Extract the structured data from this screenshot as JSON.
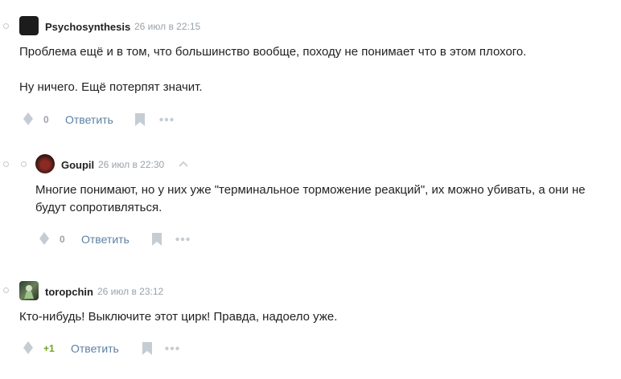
{
  "comments": [
    {
      "author": "Psychosynthesis",
      "time": "26 июл в 22:15",
      "text1": "Проблема ещё и в том, что большинство вообще, походу не понимает что в этом плохого.",
      "text2": "Ну ничего. Ещё потерпят значит.",
      "votes": "0",
      "reply_label": "Ответить"
    },
    {
      "author": "Goupil",
      "time": "26 июл в 22:30",
      "text1": "Многие понимают, но у них уже \"терминальное торможение реакций\", их можно убивать, а они не",
      "text2": "будут сопротивляться.",
      "votes": "0",
      "reply_label": "Ответить"
    },
    {
      "author": "toropchin",
      "time": "26 июл в 23:12",
      "text1": "Кто-нибудь! Выключите этот цирк! Правда, надоело уже.",
      "votes": "+1",
      "reply_label": "Ответить"
    }
  ],
  "colors": {
    "link": "#5c80a4",
    "positive": "#6aa321",
    "muted": "#9aa2aa",
    "icon": "#c5ccd3"
  },
  "icons": [
    "vote-icon",
    "bookmark-icon",
    "more-icon",
    "collapse-up-icon"
  ]
}
